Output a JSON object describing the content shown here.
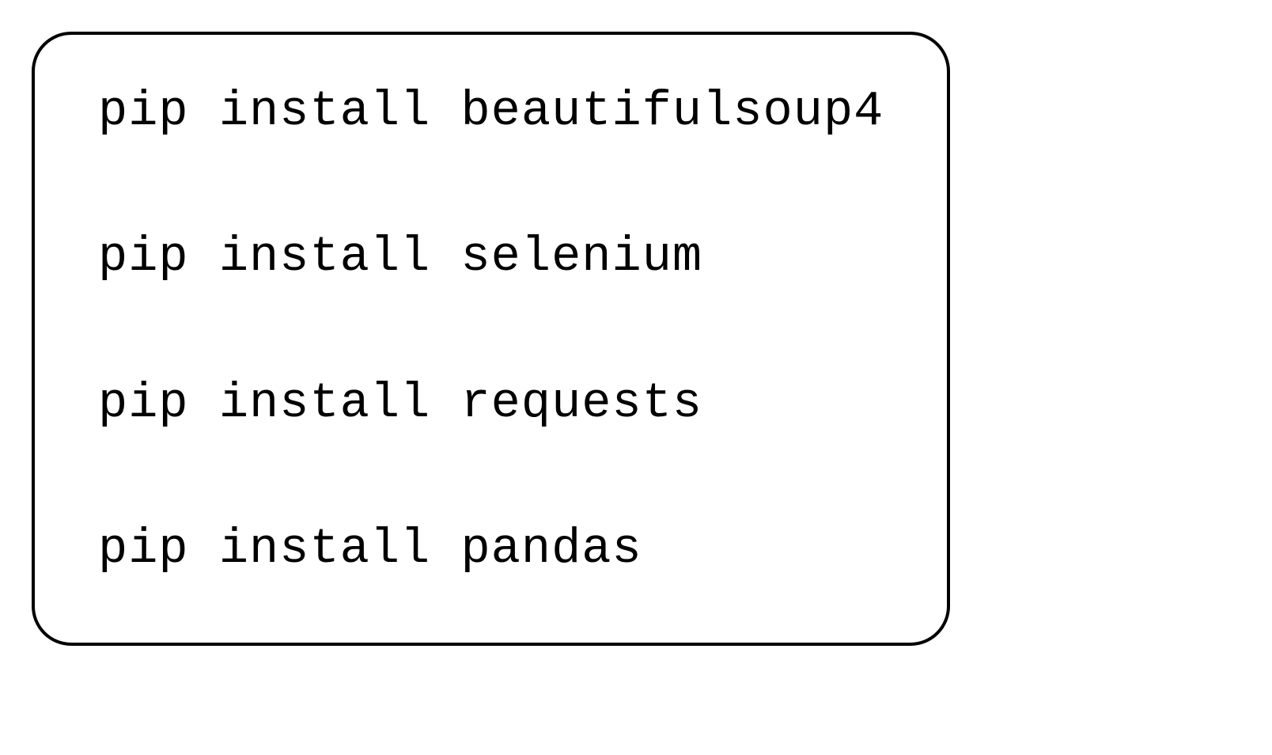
{
  "code": {
    "lines": [
      "pip install beautifulsoup4",
      "pip install selenium",
      "pip install requests",
      "pip install pandas"
    ]
  }
}
